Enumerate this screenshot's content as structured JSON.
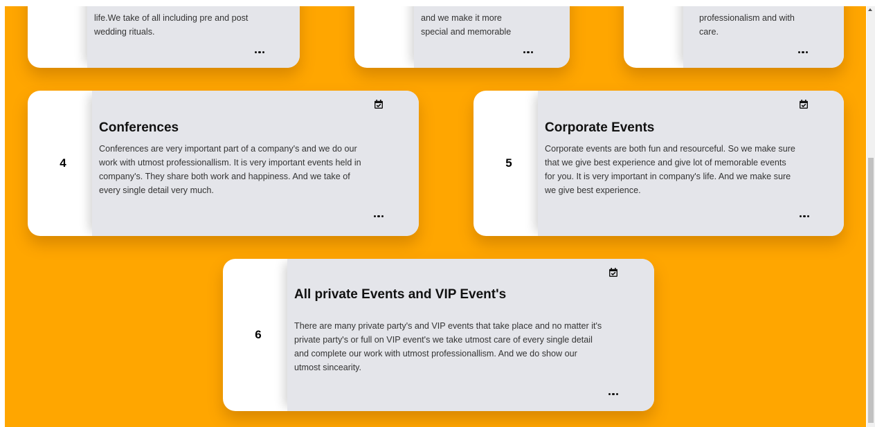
{
  "colors": {
    "background": "#ffa600",
    "card": "#ffffff",
    "card_body": "#e4e5ea",
    "text": "#333333"
  },
  "icons": {
    "calendar": "calendar-check-icon",
    "more": "ellipsis-icon"
  },
  "top_cards": [
    {
      "text_lines": [
        "life.We take of all including pre and post",
        "wedding rituals."
      ]
    },
    {
      "text_lines": [
        "and we make it more",
        "special and memorable"
      ]
    },
    {
      "text_lines": [
        "professionalism and with",
        "care."
      ]
    }
  ],
  "cards": [
    {
      "number": "4",
      "title": "Conferences",
      "text_lines": [
        "Conferences are very important part of a company's and we do our",
        "work with utmost professionallism. It is very important events held in",
        "company's. They share both work and happiness. And we take of",
        "every single detail very much."
      ]
    },
    {
      "number": "5",
      "title": "Corporate Events",
      "text_lines": [
        "Corporate events are both fun and resourceful. So we make sure",
        "that we give best experience and give lot of memorable events",
        "for you. It is very important in company's life. And we make sure",
        "we give best experience."
      ]
    },
    {
      "number": "6",
      "title": "All private Events and VIP Event's",
      "text_lines": [
        "There are many private party's and VIP events that take place and no matter it's",
        "private party's or full on VIP event's we take utmost care of every single detail",
        "and complete our work with utmost professionallism. And we do show our",
        "utmost sincearity."
      ]
    }
  ]
}
